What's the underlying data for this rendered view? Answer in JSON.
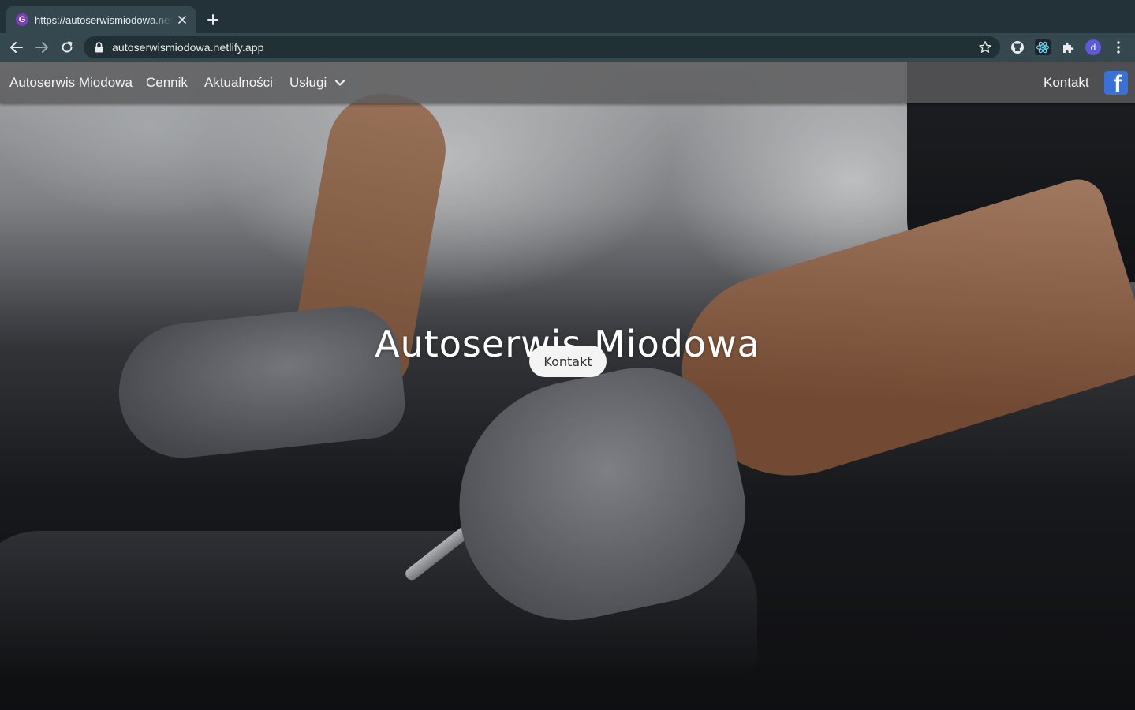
{
  "browser": {
    "tab_title": "https://autoserwismiodowa.netlify.app",
    "favicon_icon": "gatsby-favicon-icon",
    "url": "autoserwismiodowa.netlify.app",
    "profile_initial": "d"
  },
  "navbar": {
    "brand": "Autoserwis Miodowa",
    "links": [
      "Cennik",
      "Aktualności",
      "Usługi"
    ],
    "contact": "Kontakt",
    "social_icon": "facebook-icon"
  },
  "hero": {
    "title": "Autoserwis Miodowa",
    "button_label": "Kontakt"
  },
  "colors": {
    "chrome_tabstrip": "#223238",
    "chrome_toolbar": "#35484f",
    "navbar_bg": "#5a5a5c",
    "facebook_blue": "#3b70d6"
  }
}
